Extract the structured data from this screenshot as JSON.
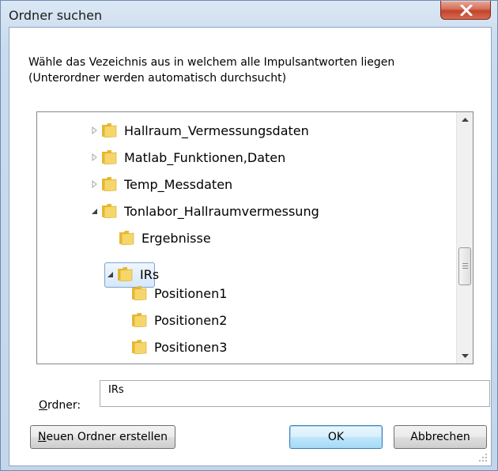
{
  "window": {
    "title": "Ordner suchen"
  },
  "description": {
    "line1": "Wähle das Vezeichnis aus in welchem alle Impulsantworten liegen",
    "line2": "(Unterordner werden automatisch durchsucht)"
  },
  "tree": {
    "items": [
      {
        "label": "Hallraum_Vermessungsdaten",
        "expander": "collapsed"
      },
      {
        "label": "Matlab_Funktionen,Daten",
        "expander": "collapsed"
      },
      {
        "label": "Temp_Messdaten",
        "expander": "collapsed"
      },
      {
        "label": "Tonlabor_Hallraumvermessung",
        "expander": "expanded"
      },
      {
        "label": "Ergebnisse",
        "expander": "none"
      },
      {
        "label": "IRs",
        "expander": "expanded",
        "selected": true
      },
      {
        "label": "Positionen1",
        "expander": "none"
      },
      {
        "label": "Positionen2",
        "expander": "none"
      },
      {
        "label": "Positionen3",
        "expander": "none"
      }
    ]
  },
  "folder_field": {
    "label": "Ordner:",
    "value": "IRs"
  },
  "buttons": {
    "new_folder": "Neuen Ordner erstellen",
    "ok": "OK",
    "cancel": "Abbrechen"
  },
  "icons": {
    "close": "close-icon",
    "folder": "folder-icon",
    "expander_collapsed": "triangle-right-icon",
    "expander_expanded": "triangle-down-icon"
  },
  "colors": {
    "close_button": "#c7472f",
    "selection": "#d6e8fb",
    "default_button": "#bee6fd"
  }
}
